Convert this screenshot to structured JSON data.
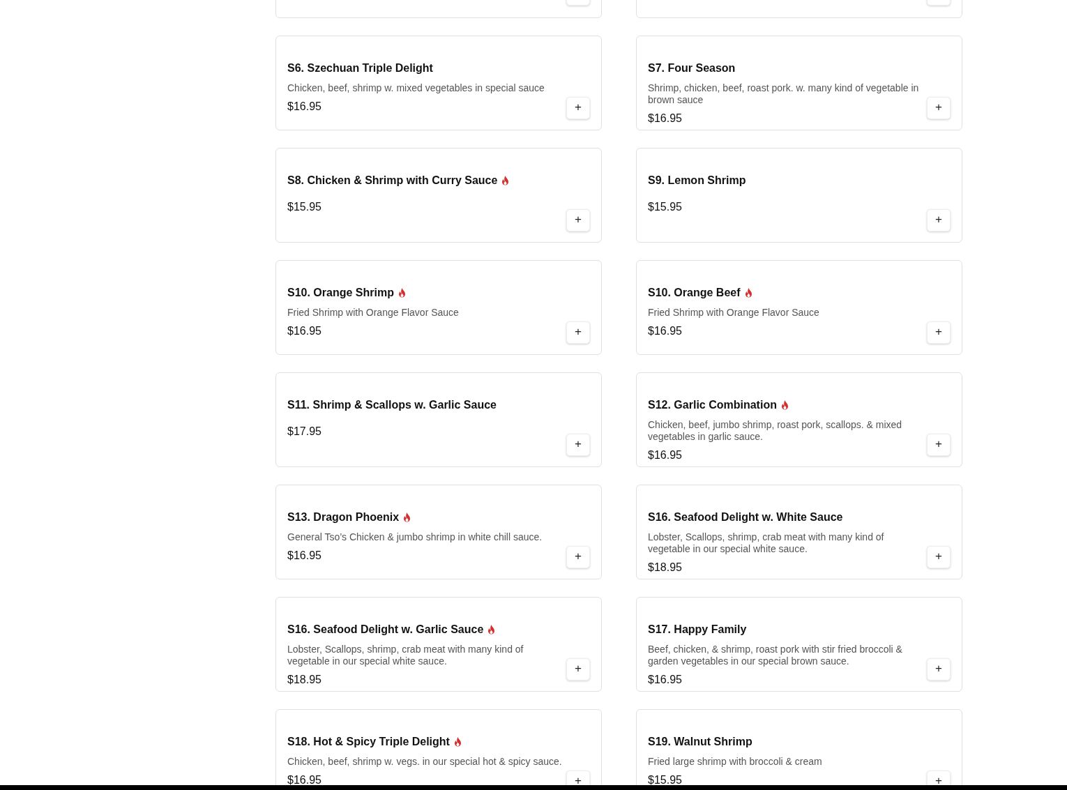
{
  "items": [
    {
      "kind": "dish",
      "name": "S6. Szechuan Triple Delight",
      "spicy": false,
      "description": "Chicken, beef, shrimp w. mixed vegetables in special sauce",
      "price": "$16.95",
      "add_button": "+"
    },
    {
      "kind": "dish",
      "name": "S7. Four Season",
      "spicy": false,
      "description": "Shrimp, chicken, beef, roast pork. w. many kind of vegetable in brown sauce",
      "price": "$16.95",
      "add_button": "+"
    },
    {
      "kind": "dish",
      "name": "S8. Chicken & Shrimp with Curry Sauce",
      "spicy": true,
      "price": "$15.95",
      "add_button": "+"
    },
    {
      "kind": "dish",
      "name": "S9. Lemon Shrimp",
      "spicy": false,
      "price": "$15.95",
      "add_button": "+"
    },
    {
      "kind": "dish",
      "name": "S10. Orange Shrimp",
      "spicy": true,
      "description": "Fried Shrimp with Orange Flavor Sauce",
      "price": "$16.95",
      "add_button": "+"
    },
    {
      "kind": "dish",
      "name": "S10. Orange Beef",
      "spicy": true,
      "description": "Fried Shrimp with Orange Flavor Sauce",
      "price": "$16.95",
      "add_button": "+"
    },
    {
      "kind": "dish",
      "name": "S11. Shrimp & Scallops w. Garlic Sauce",
      "spicy": false,
      "price": "$17.95",
      "add_button": "+"
    },
    {
      "kind": "dish",
      "name": "S12. Garlic Combination",
      "spicy": true,
      "description": "Chicken, beef, jumbo shrimp, roast pork, scallops. & mixed vegetables in garlic sauce.",
      "price": "$16.95",
      "add_button": "+"
    },
    {
      "kind": "dish",
      "name": "S13. Dragon Phoenix",
      "spicy": true,
      "description": "General Tso’s Chicken & jumbo shrimp in white chill sauce.",
      "price": "$16.95",
      "add_button": "+"
    },
    {
      "kind": "dish",
      "name": "S16. Seafood Delight w. White Sauce",
      "spicy": false,
      "description": "Lobster, Scallops, shrimp, crab meat with many kind of vegetable in our special white sauce.",
      "price": "$18.95",
      "add_button": "+"
    },
    {
      "kind": "dish",
      "name": "S16. Seafood Delight w. Garlic Sauce",
      "spicy": true,
      "description": "Lobster, Scallops, shrimp, crab meat with many kind of vegetable in our special white sauce.",
      "price": "$18.95",
      "add_button": "+"
    },
    {
      "kind": "dish",
      "name": "S17. Happy Family",
      "spicy": false,
      "description": "Beef, chicken, & shrimp, roast pork with stir fried broccoli & garden vegetables in our special brown sauce.",
      "price": "$16.95",
      "add_button": "+"
    },
    {
      "kind": "dish",
      "name": "S18. Hot & Spicy Triple Delight",
      "spicy": true,
      "description": "Chicken, beef, shrimp w. vegs. in our special hot & spicy sauce.",
      "price": "$16.95",
      "add_button": "+"
    },
    {
      "kind": "dish",
      "name": "S19. Walnut Shrimp",
      "spicy": false,
      "description": "Fried large shrimp with broccoli & cream",
      "price": "$15.95",
      "add_button": "+"
    }
  ]
}
